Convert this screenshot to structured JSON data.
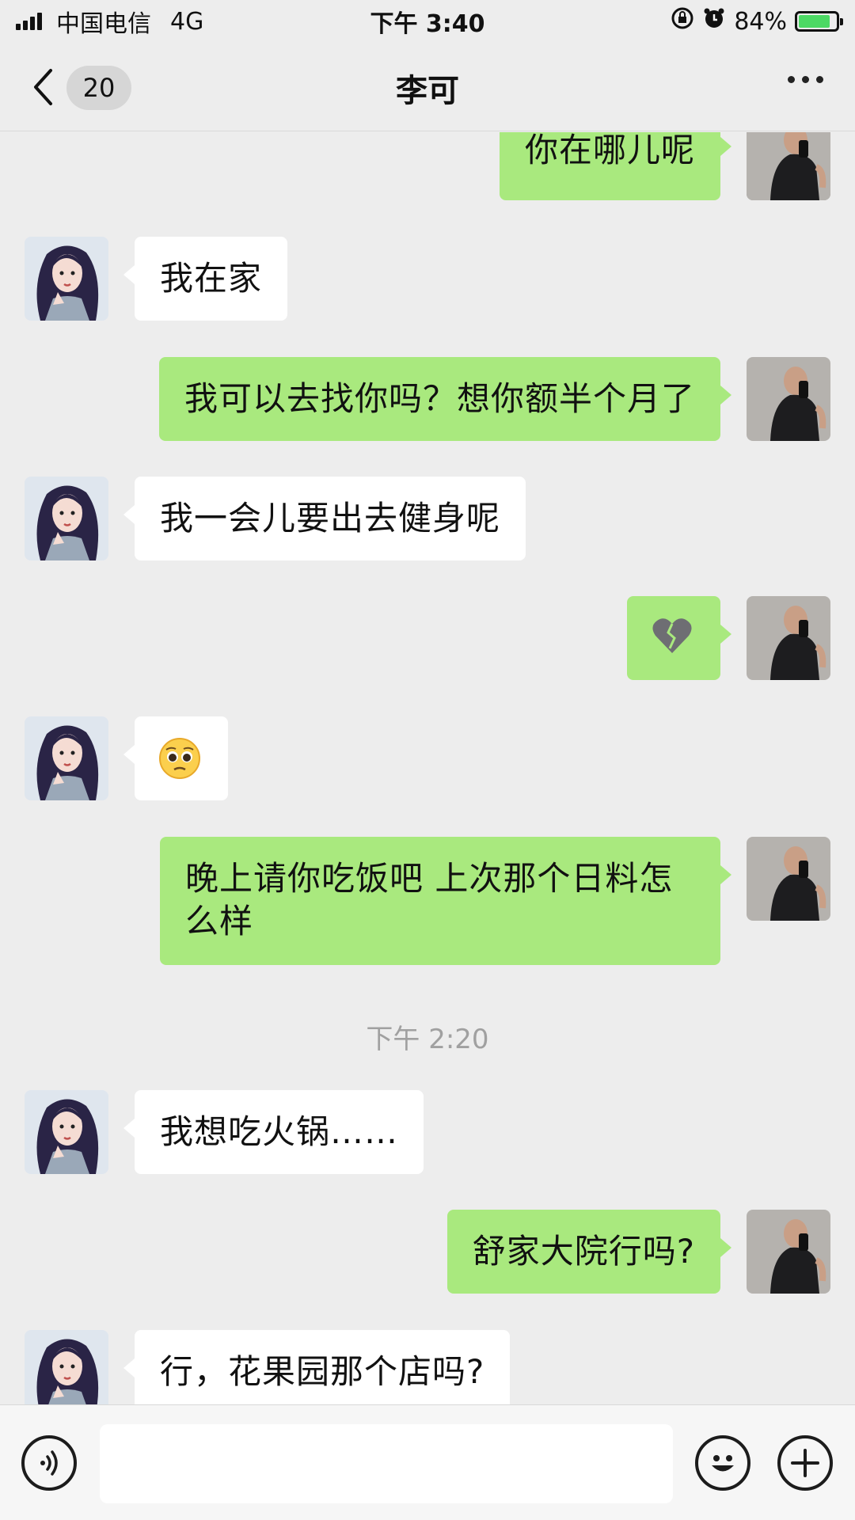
{
  "status_bar": {
    "carrier": "中国电信",
    "network": "4G",
    "time": "下午 3:40",
    "battery_percent": "84%",
    "battery_level": 0.84
  },
  "nav": {
    "back_count": "20",
    "title": "李可"
  },
  "messages": [
    {
      "side": "out",
      "text": "你在哪儿呢"
    },
    {
      "side": "in",
      "text": "我在家"
    },
    {
      "side": "out",
      "text": "我可以去找你吗？想你额半个月了"
    },
    {
      "side": "in",
      "text": "我一会儿要出去健身呢"
    },
    {
      "side": "out",
      "text": "💔",
      "emoji": "broken-heart"
    },
    {
      "side": "in",
      "text": "🥺",
      "emoji": "pleading-face"
    },
    {
      "side": "out",
      "text": "晚上请你吃饭吧 上次那个日料怎么样"
    },
    {
      "side": "in",
      "text": "我想吃火锅……"
    },
    {
      "side": "out",
      "text": "舒家大院行吗?"
    },
    {
      "side": "in",
      "text": "行，花果园那个店吗?"
    }
  ],
  "timestamp": "下午 2:20",
  "input": {
    "placeholder": "",
    "value": ""
  },
  "colors": {
    "outgoing_bubble": "#a9e97e",
    "incoming_bubble": "#ffffff",
    "background": "#ededed"
  },
  "icons": [
    "signal-icon",
    "lock-rotation-icon",
    "alarm-icon",
    "battery-icon",
    "back-chevron-icon",
    "more-icon",
    "voice-icon",
    "emoji-icon",
    "plus-icon"
  ]
}
